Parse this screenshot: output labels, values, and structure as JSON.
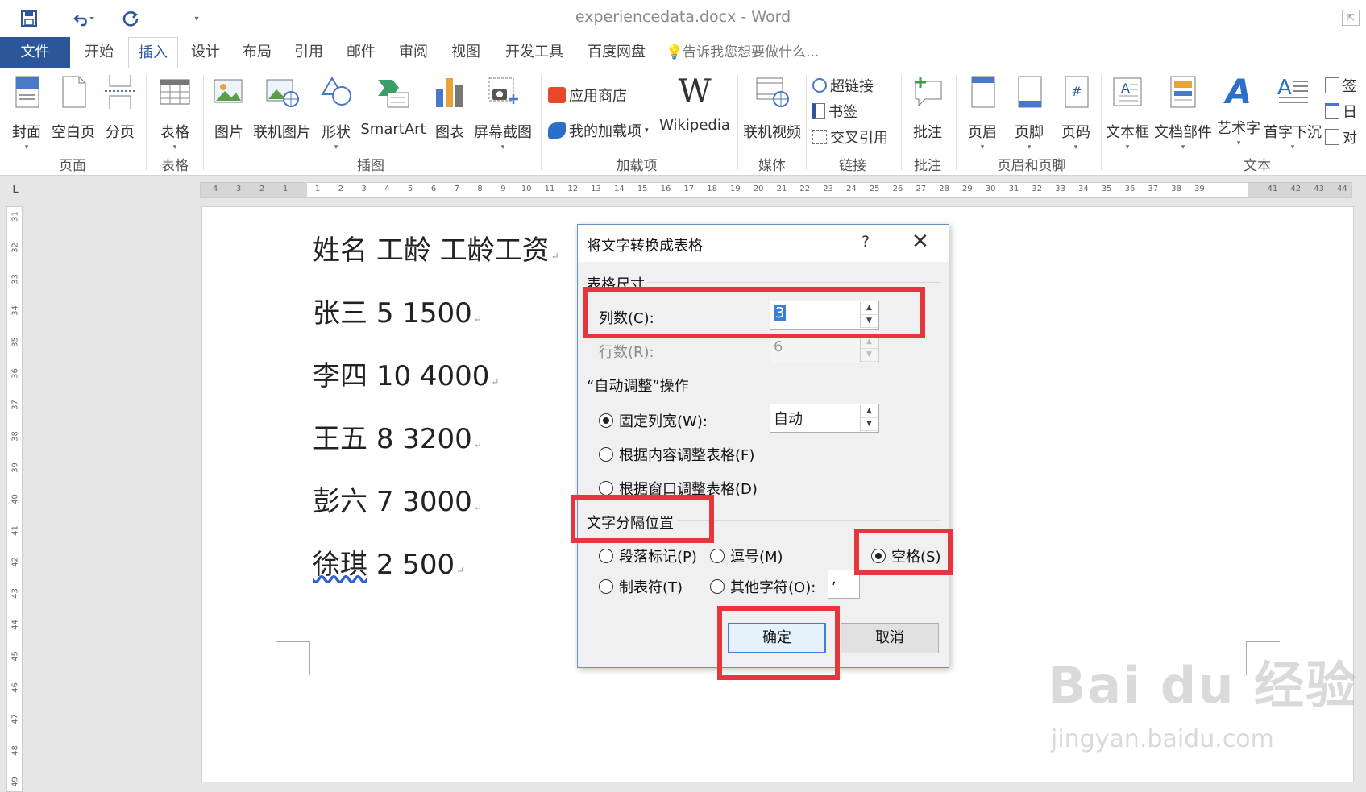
{
  "window": {
    "title": "experiencedata.docx - Word",
    "restore_icon": "restore-icon"
  },
  "tabs": [
    "文件",
    "开始",
    "插入",
    "设计",
    "布局",
    "引用",
    "邮件",
    "审阅",
    "视图",
    "开发工具",
    "百度网盘"
  ],
  "active_tab": "插入",
  "tell_me": "告诉我您想要做什么...",
  "ribbon": {
    "pages": {
      "cover": "封面",
      "blank": "空白页",
      "break": "分页",
      "group": "页面"
    },
    "tables": {
      "table": "表格",
      "group": "表格"
    },
    "illustrations": {
      "picture": "图片",
      "online_picture": "联机图片",
      "shapes": "形状",
      "smartart": "SmartArt",
      "chart": "图表",
      "screenshot": "屏幕截图",
      "group": "插图"
    },
    "addins": {
      "store": "应用商店",
      "my_addins": "我的加载项",
      "wikipedia": "Wikipedia",
      "group": "加载项",
      "wiki_logo": "W"
    },
    "media": {
      "online_video": "联机视频",
      "group": "媒体"
    },
    "links": {
      "hyperlink": "超链接",
      "bookmark": "书签",
      "crossref": "交叉引用",
      "group": "链接"
    },
    "comments": {
      "comment": "批注",
      "group": "批注"
    },
    "header_footer": {
      "header": "页眉",
      "footer": "页脚",
      "page_number": "页码",
      "group": "页眉和页脚"
    },
    "text": {
      "textbox": "文本框",
      "quickparts": "文档部件",
      "wordart": "艺术字",
      "dropcap": "首字下沉",
      "group": "文本",
      "signature": "签",
      "date": "日",
      "object": "对"
    }
  },
  "ruler": {
    "h_ticks": [
      "4",
      "3",
      "2",
      "1",
      "1",
      "2",
      "3",
      "4",
      "5",
      "6",
      "7",
      "8",
      "9",
      "10",
      "11",
      "12",
      "13",
      "14",
      "15",
      "16",
      "17",
      "18",
      "19",
      "20",
      "21",
      "22",
      "23",
      "24",
      "25",
      "26",
      "27",
      "28",
      "29",
      "30",
      "31",
      "32",
      "33",
      "34",
      "35",
      "36",
      "37",
      "38",
      "39",
      "41",
      "42",
      "43",
      "44"
    ],
    "v_ticks": [
      "31",
      "32",
      "33",
      "34",
      "35",
      "36",
      "37",
      "38",
      "39",
      "40",
      "41",
      "42",
      "43",
      "44",
      "45",
      "46",
      "47",
      "48",
      "49"
    ],
    "corner": "L"
  },
  "document": {
    "lines": [
      {
        "name": "姓名",
        "rest": "工龄  工龄工资"
      },
      {
        "name": "张三",
        "rest": "5 1500"
      },
      {
        "name": "李四",
        "rest": "10 4000"
      },
      {
        "name": "王五",
        "rest": "8 3200"
      },
      {
        "name": "彭六",
        "rest": "7 3000"
      },
      {
        "name": "徐琪",
        "rest": "2 500"
      }
    ],
    "para_mark": "↵"
  },
  "dialog": {
    "title": "将文字转换成表格",
    "help": "?",
    "close": "✕",
    "table_size_label": "表格尺寸",
    "columns_label": "列数(C):",
    "columns_value": "3",
    "rows_label": "行数(R):",
    "rows_value": "6",
    "autofit_label": "“自动调整”操作",
    "fixed_width_label": "固定列宽(W):",
    "fixed_width_value": "自动",
    "autofit_content_label": "根据内容调整表格(F)",
    "autofit_window_label": "根据窗口调整表格(D)",
    "separator_label": "文字分隔位置",
    "paragraph_label": "段落标记(P)",
    "comma_label": "逗号(M)",
    "space_label": "空格(S)",
    "tab_label": "制表符(T)",
    "other_label": "其他字符(O):",
    "other_value": ",",
    "ok_label": "确定",
    "cancel_label": "取消",
    "fixed_width_selected": true,
    "space_selected": true
  },
  "watermark": {
    "logo": "Bai du 经验",
    "url": "jingyan.baidu.com"
  },
  "colors": {
    "accent": "#2b579a",
    "highlight": "#e8343f",
    "dialog_border": "#6a8fc8"
  }
}
